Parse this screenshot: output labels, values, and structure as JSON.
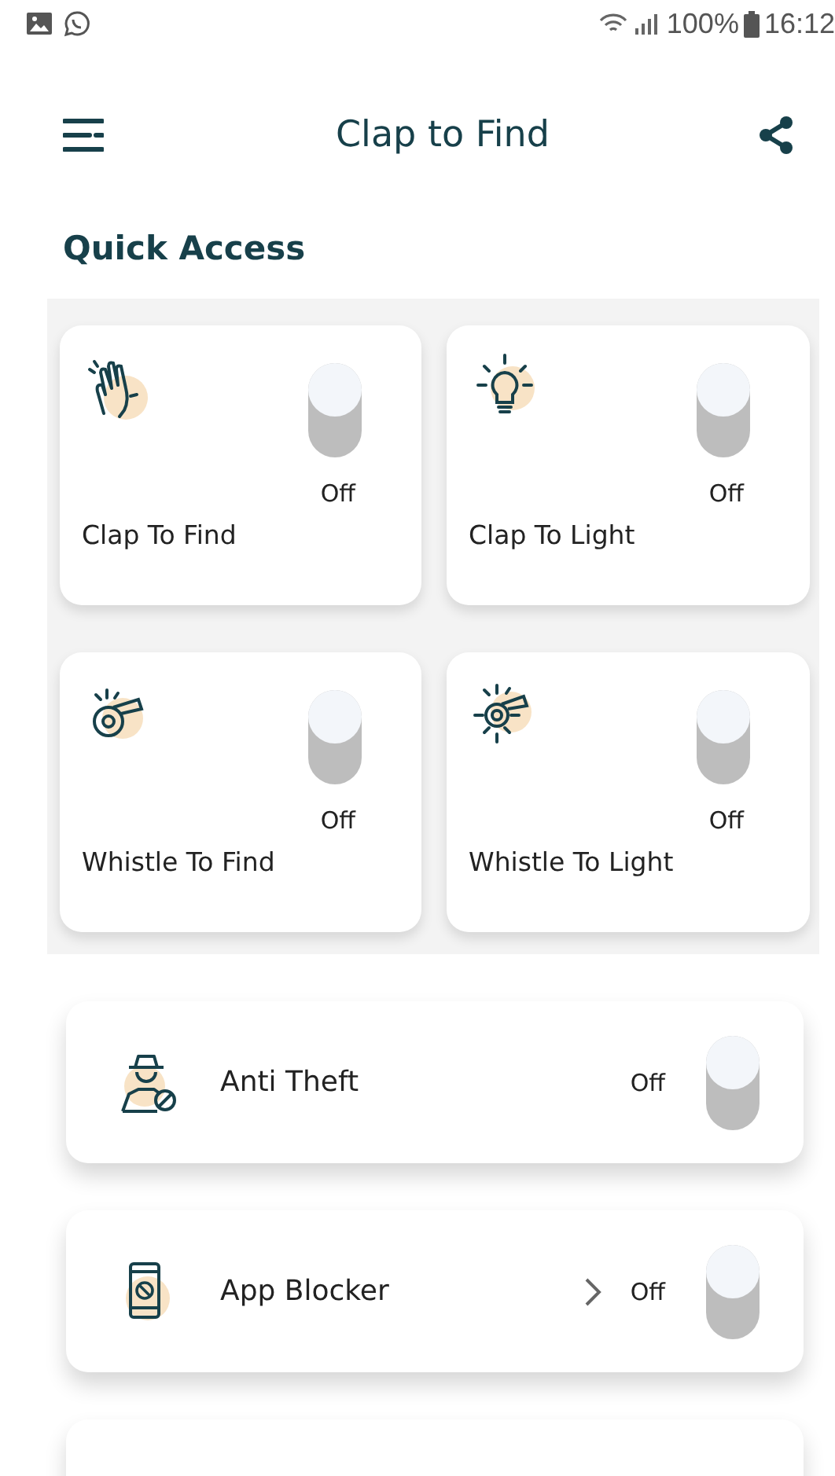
{
  "status_bar": {
    "battery": "100%",
    "time": "16:12"
  },
  "header": {
    "title": "Clap to Find"
  },
  "section_title": "Quick Access",
  "quick": [
    {
      "kind": "clap",
      "label": "Clap To Find",
      "state": "Off",
      "on": false
    },
    {
      "kind": "bulb",
      "label": "Clap To Light",
      "state": "Off",
      "on": false
    },
    {
      "kind": "whistle",
      "label": "Whistle To Find",
      "state": "Off",
      "on": false
    },
    {
      "kind": "whistle-light",
      "label": "Whistle To Light",
      "state": "Off",
      "on": false
    }
  ],
  "features": [
    {
      "kind": "spy",
      "label": "Anti Theft",
      "state": "Off",
      "on": false,
      "chevron": false
    },
    {
      "kind": "phone-block",
      "label": "App Blocker",
      "state": "Off",
      "on": false,
      "chevron": true
    }
  ]
}
